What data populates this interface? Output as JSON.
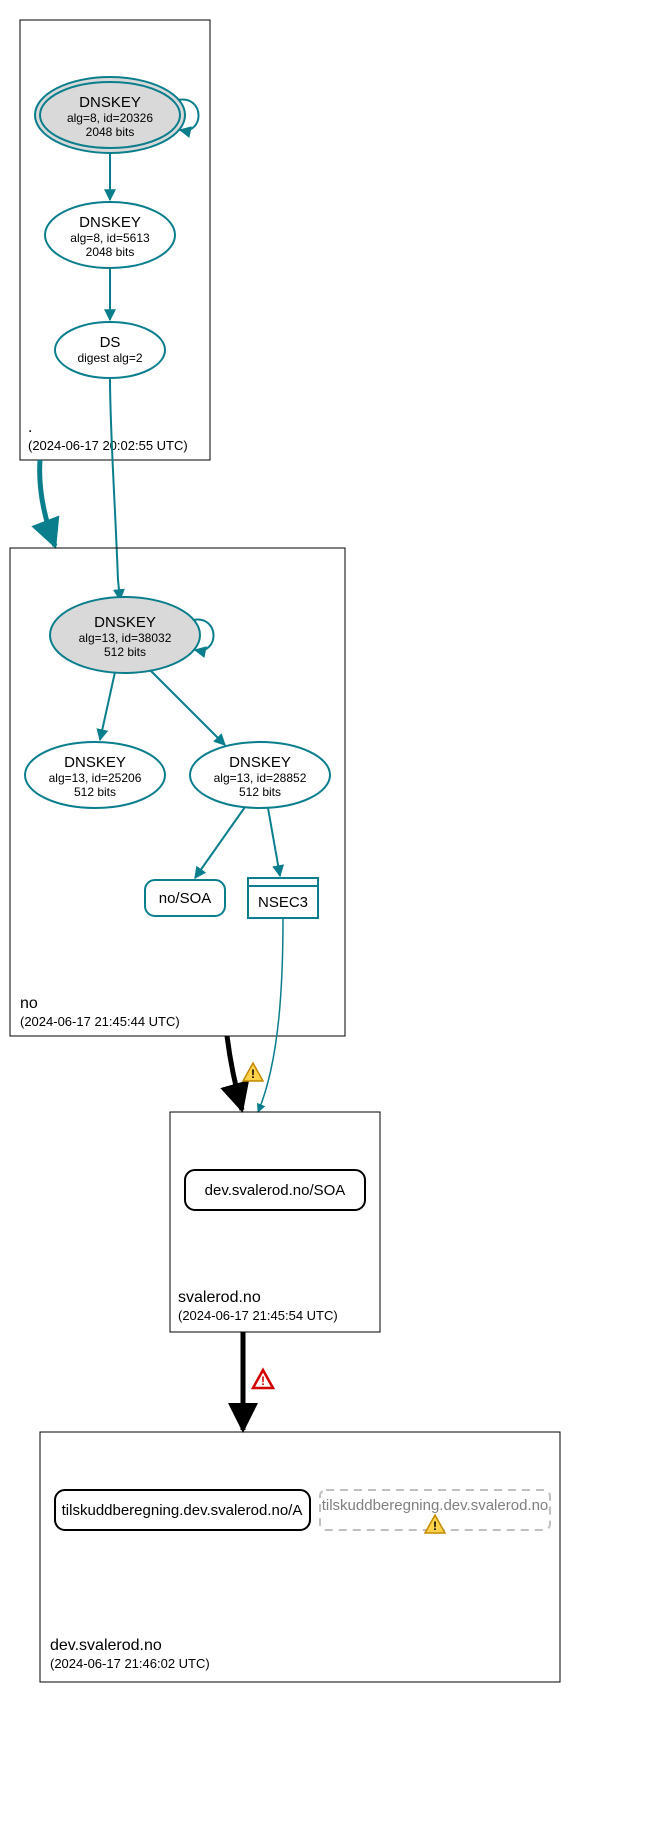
{
  "chart_data": {
    "type": "dnssec-delegation-graph",
    "zones": [
      {
        "name": ".",
        "time": "(2024-06-17 20:02:55 UTC)",
        "nodes": [
          {
            "id": "root-ksk",
            "type": "dnskey",
            "ksk": true,
            "lines": [
              "DNSKEY",
              "alg=8, id=20326",
              "2048 bits"
            ]
          },
          {
            "id": "root-zsk",
            "type": "dnskey",
            "lines": [
              "DNSKEY",
              "alg=8, id=5613",
              "2048 bits"
            ]
          },
          {
            "id": "root-ds",
            "type": "ds",
            "lines": [
              "DS",
              "digest alg=2"
            ]
          }
        ],
        "edges": [
          [
            "root-ksk",
            "root-ksk",
            "self"
          ],
          [
            "root-ksk",
            "root-zsk"
          ],
          [
            "root-zsk",
            "root-ds"
          ]
        ]
      },
      {
        "name": "no",
        "time": "(2024-06-17 21:45:44 UTC)",
        "nodes": [
          {
            "id": "no-ksk",
            "type": "dnskey",
            "ksk": true,
            "lines": [
              "DNSKEY",
              "alg=13, id=38032",
              "512 bits"
            ]
          },
          {
            "id": "no-zsk1",
            "type": "dnskey",
            "lines": [
              "DNSKEY",
              "alg=13, id=25206",
              "512 bits"
            ]
          },
          {
            "id": "no-zsk2",
            "type": "dnskey",
            "lines": [
              "DNSKEY",
              "alg=13, id=28852",
              "512 bits"
            ]
          },
          {
            "id": "no-soa",
            "type": "record",
            "label": "no/SOA"
          },
          {
            "id": "no-nsec",
            "type": "nsec3",
            "label": "NSEC3"
          }
        ],
        "edges": [
          [
            "root-ds",
            "no-ksk",
            "deleg-secure"
          ],
          [
            "no-ksk",
            "no-ksk",
            "self"
          ],
          [
            "no-ksk",
            "no-zsk1"
          ],
          [
            "no-ksk",
            "no-zsk2"
          ],
          [
            "no-zsk2",
            "no-soa"
          ],
          [
            "no-zsk2",
            "no-nsec"
          ]
        ]
      },
      {
        "name": "svalerod.no",
        "time": "(2024-06-17 21:45:54 UTC)",
        "nodes": [
          {
            "id": "sv-soa",
            "type": "record",
            "black": true,
            "label": "dev.svalerod.no/SOA"
          }
        ],
        "edges": [
          [
            "no-nsec",
            "sv-soa",
            "insecure-warn"
          ],
          [
            "no-zsk2",
            "sv-soa",
            "insecure-plain"
          ]
        ]
      },
      {
        "name": "dev.svalerod.no",
        "time": "(2024-06-17 21:46:02 UTC)",
        "nodes": [
          {
            "id": "dev-a",
            "type": "record",
            "black": true,
            "label": "tilskuddberegning.dev.svalerod.no/A"
          },
          {
            "id": "dev-ghost",
            "type": "ghost",
            "label": "tilskuddberegning.dev.svalerod.no"
          }
        ],
        "edges": [
          [
            "sv-soa",
            "dev-a",
            "insecure-error"
          ]
        ]
      }
    ]
  },
  "labels": {
    "root_name": ".",
    "root_time": "(2024-06-17 20:02:55 UTC)",
    "no_name": "no",
    "no_time": "(2024-06-17 21:45:44 UTC)",
    "sv_name": "svalerod.no",
    "sv_time": "(2024-06-17 21:45:54 UTC)",
    "dev_name": "dev.svalerod.no",
    "dev_time": "(2024-06-17 21:46:02 UTC)",
    "dnskey": "DNSKEY",
    "root_ksk_l2": "alg=8, id=20326",
    "root_ksk_l3": "2048 bits",
    "root_zsk_l2": "alg=8, id=5613",
    "root_zsk_l3": "2048 bits",
    "ds": "DS",
    "ds_l2": "digest alg=2",
    "no_ksk_l2": "alg=13, id=38032",
    "no_ksk_l3": "512 bits",
    "no_zsk1_l2": "alg=13, id=25206",
    "no_zsk1_l3": "512 bits",
    "no_zsk2_l2": "alg=13, id=28852",
    "no_zsk2_l3": "512 bits",
    "no_soa": "no/SOA",
    "nsec3": "NSEC3",
    "sv_soa": "dev.svalerod.no/SOA",
    "dev_a": "tilskuddberegning.dev.svalerod.no/A",
    "dev_ghost": "tilskuddberegning.dev.svalerod.no"
  }
}
